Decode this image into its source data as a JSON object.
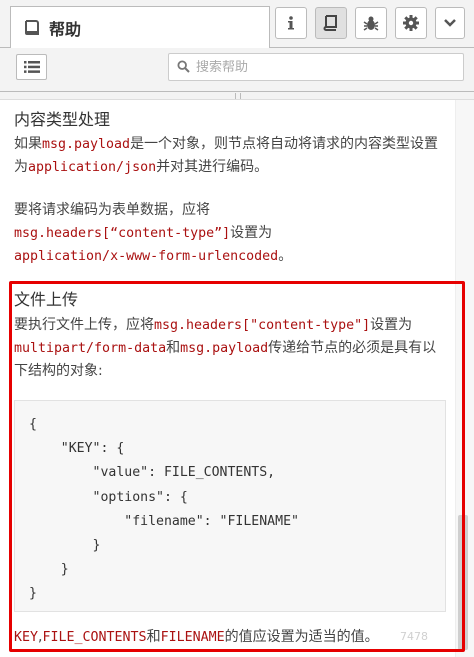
{
  "header": {
    "tab_title": "帮助",
    "buttons": [
      {
        "name": "info-button",
        "icon": "info-icon"
      },
      {
        "name": "help-button",
        "icon": "book-icon",
        "active": true
      },
      {
        "name": "debug-button",
        "icon": "bug-icon"
      },
      {
        "name": "settings-button",
        "icon": "gear-icon"
      },
      {
        "name": "more-button",
        "icon": "chevron-down-icon"
      }
    ]
  },
  "search": {
    "placeholder": "搜索帮助",
    "value": ""
  },
  "content": {
    "section1": {
      "heading": "内容类型处理",
      "p1": {
        "t1": "如果",
        "c1": "msg.payload",
        "t2": "是一个对象，则节点将自动将请求的内容类型设置为",
        "c2": "application/json",
        "t3": "并对其进行编码。"
      },
      "p2": {
        "t1": "要将请求编码为表单数据，应将",
        "c1": "msg.headers[“content-type”]",
        "t2": "设置为",
        "c2": "application/x-www-form-urlencoded",
        "t3": "。"
      }
    },
    "section2": {
      "heading": "文件上传",
      "p1": {
        "t1": "要执行文件上传，应将",
        "c1": "msg.headers[\"content-type\"]",
        "t2": "设置为",
        "c2": "multipart/form-data",
        "t3": "和",
        "c3": "msg.payload",
        "t4": "传递给节点的必须是具有以下结构的对象:"
      },
      "code_block": "{\n    \"KEY\": {\n        \"value\": FILE_CONTENTS,\n        \"options\": {\n            \"filename\": \"FILENAME\"\n        }\n    }\n}",
      "p2": {
        "c1": "KEY",
        "t1": ",",
        "c2": "FILE_CONTENTS",
        "t2": "和",
        "c3": "FILENAME",
        "t3": "的值应设置为适当的值。"
      }
    },
    "watermark": "7478"
  },
  "colors": {
    "code_red": "#aa1111",
    "highlight_red": "#e60000",
    "header_bg": "#f3f3f3"
  }
}
